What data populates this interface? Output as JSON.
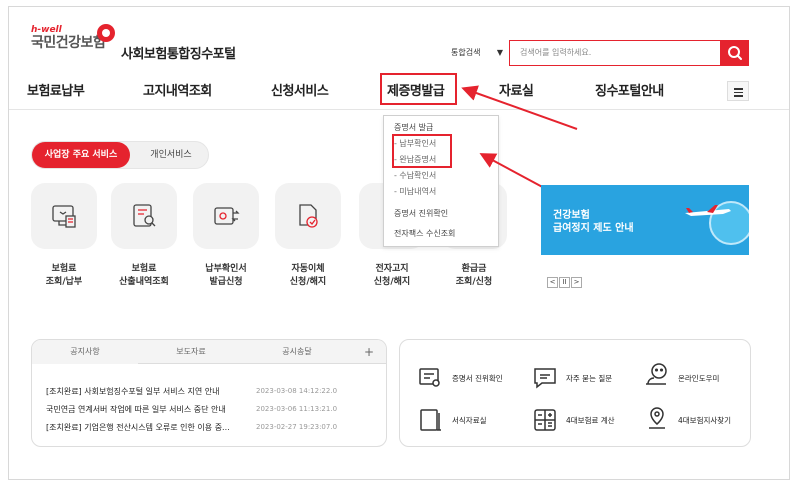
{
  "header": {
    "logo_small": "h-well",
    "logo_main": "국민건강보험",
    "portal_title": "사회보험통합징수포털",
    "search_scope": "통합검색",
    "search_placeholder": "검색어를 입력하세요."
  },
  "nav": {
    "items": [
      "보험료납부",
      "고지내역조회",
      "신청서비스",
      "제증명발급",
      "자료실",
      "징수포털안내"
    ],
    "highlighted": "제증명발급"
  },
  "tabs": {
    "active": "사업장 주요 서비스",
    "inactive": "개인서비스"
  },
  "services": [
    {
      "line1": "보험료",
      "line2": "조회/납부"
    },
    {
      "line1": "보험료",
      "line2": "산출내역조회"
    },
    {
      "line1": "납부확인서",
      "line2": "발급신청"
    },
    {
      "line1": "자동이체",
      "line2": "신청/해지"
    },
    {
      "line1": "전자고지",
      "line2": "신청/해지"
    },
    {
      "line1": "환급금",
      "line2": "조회/신청"
    }
  ],
  "dropdown": {
    "header": "증명서 발급",
    "sub_items": [
      "- 납부확인서",
      "- 완납증명서",
      "- 수납확인서",
      "- 미납내역서"
    ],
    "item2": "증명서 진위확인",
    "item3": "전자팩스 수신조회"
  },
  "banner": {
    "line1": "건강보험",
    "line2": "급여정지 제도 안내"
  },
  "pager": {
    "prev": "<",
    "pause": "II",
    "next": ">"
  },
  "notice": {
    "tabs": [
      "공지사항",
      "보도자료",
      "공시송달",
      "+"
    ],
    "rows": [
      {
        "title": "[조치완료] 사회보험징수포털 일부 서비스 지연 안내",
        "date": "2023-03-08 14:12:22.0"
      },
      {
        "title": "국민연금 연계서버 작업에 따른 일부 서비스 중단 안내",
        "date": "2023-03-06 11:13:21.0"
      },
      {
        "title": "[조치완료] 기업은행 전산시스템 오류로 인한 이용 중...",
        "date": "2023-02-27 19:23:07.0"
      }
    ]
  },
  "quick_links": [
    {
      "label": "증명서 진위확인",
      "icon": "certificate-check-icon"
    },
    {
      "label": "자주 묻는 질문",
      "icon": "chat-bubble-icon"
    },
    {
      "label": "온라인도우미",
      "icon": "helper-icon"
    },
    {
      "label": "서식자료실",
      "icon": "document-form-icon"
    },
    {
      "label": "4대보험료 계산",
      "icon": "calculator-icon"
    },
    {
      "label": "4대보험지사찾기",
      "icon": "location-pin-icon"
    }
  ],
  "colors": {
    "accent": "#e5232e",
    "banner": "#29a3e0"
  }
}
